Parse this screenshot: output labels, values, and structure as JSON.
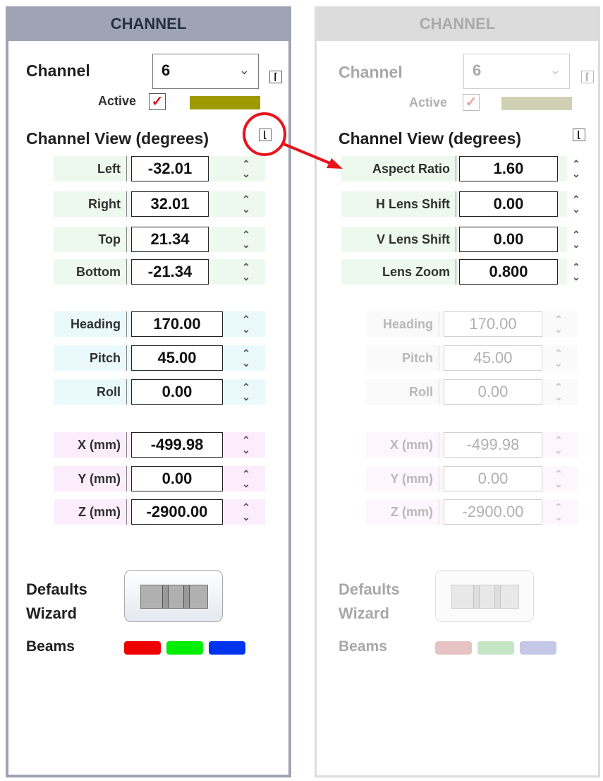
{
  "left_panel": {
    "header": "CHANNEL",
    "channel_label": "Channel",
    "channel_value": "6",
    "active_label": "Active",
    "active_checked": true,
    "active_color": "#9c9a00",
    "channel_view_label": "Channel View (degrees)",
    "rows": [
      {
        "label": "Left",
        "value": "-32.01"
      },
      {
        "label": "Right",
        "value": "32.01"
      },
      {
        "label": "Top",
        "value": "21.34"
      },
      {
        "label": "Bottom",
        "value": "-21.34"
      },
      {
        "label": "Heading",
        "value": "170.00"
      },
      {
        "label": "Pitch",
        "value": "45.00"
      },
      {
        "label": "Roll",
        "value": "0.00"
      },
      {
        "label": "X (mm)",
        "value": "-499.98"
      },
      {
        "label": "Y (mm)",
        "value": "0.00"
      },
      {
        "label": "Z (mm)",
        "value": "-2900.00"
      }
    ],
    "defaults_label_1": "Defaults",
    "defaults_label_2": "Wizard",
    "beams_label": "Beams",
    "beam_colors": [
      "#ee0000",
      "#00ee00",
      "#0033ee"
    ]
  },
  "right_panel": {
    "header": "CHANNEL",
    "channel_label": "Channel",
    "channel_value": "6",
    "active_label": "Active",
    "active_checked": true,
    "channel_view_label": "Channel View (degrees)",
    "lens_rows": [
      {
        "label": "Aspect Ratio",
        "value": "1.60"
      },
      {
        "label": "H Lens Shift",
        "value": "0.00"
      },
      {
        "label": "V Lens Shift",
        "value": "0.00"
      },
      {
        "label": "Lens Zoom",
        "value": "0.800"
      }
    ],
    "rows": [
      {
        "label": "Heading",
        "value": "170.00"
      },
      {
        "label": "Pitch",
        "value": "45.00"
      },
      {
        "label": "Roll",
        "value": "0.00"
      },
      {
        "label": "X (mm)",
        "value": "-499.98"
      },
      {
        "label": "Y (mm)",
        "value": "0.00"
      },
      {
        "label": "Z (mm)",
        "value": "-2900.00"
      }
    ],
    "defaults_label_1": "Defaults",
    "defaults_label_2": "Wizard",
    "beams_label": "Beams",
    "beam_colors": [
      "#e6c4c4",
      "#c4e6c4",
      "#c4c8e6"
    ]
  },
  "icons": {
    "dropdown": "chevron-down-icon",
    "checkmark": "checkmark-icon",
    "toggle": "corner-toggle-icon",
    "spin": "up-down-spinner-icon",
    "annotation_circle": "red-circle-highlight",
    "annotation_arrow": "red-arrow"
  }
}
